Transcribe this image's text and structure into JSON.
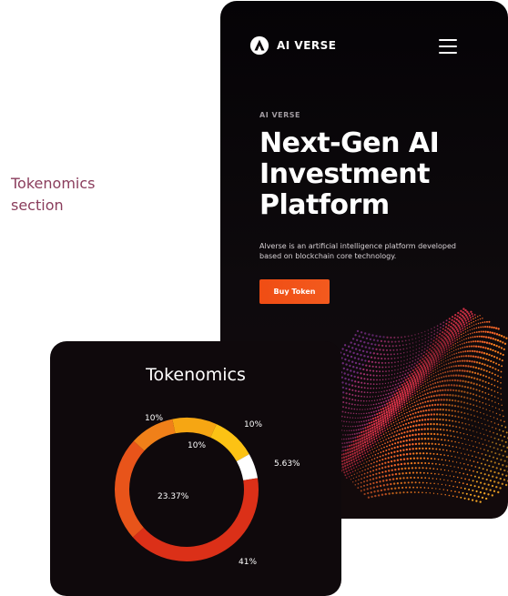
{
  "caption": {
    "text": "Tokenomics section"
  },
  "hero": {
    "brand": "AI VERSE",
    "eyebrow": "AI VERSE",
    "headline": "Next-Gen AI Investment Platform",
    "description": "Alverse is an artificial intelligence platform developed based on blockchain core technology.",
    "cta_label": "Buy Token",
    "icons": {
      "logo": "aiverse-logo-icon",
      "menu": "hamburger-menu-icon"
    }
  },
  "tokenomics": {
    "title": "Tokenomics"
  },
  "colors": {
    "accent": "#f04d14",
    "card_bg": "#0f090c",
    "phone_bg": "#050306",
    "caption": "#8a3d5c"
  },
  "chart_data": {
    "type": "pie",
    "title": "Tokenomics",
    "slices": [
      {
        "label": "10%",
        "value": 10,
        "color": "#f6a613"
      },
      {
        "label": "10%",
        "value": 10,
        "color": "#fcc214"
      },
      {
        "label": "5.63%",
        "value": 5.63,
        "color": "#ffffff"
      },
      {
        "label": "41%",
        "value": 41,
        "color": "#db3018"
      },
      {
        "label": "23.37%",
        "value": 23.37,
        "color": "#e8541a"
      },
      {
        "label": "10%",
        "value": 10,
        "color": "#f08019"
      }
    ]
  }
}
